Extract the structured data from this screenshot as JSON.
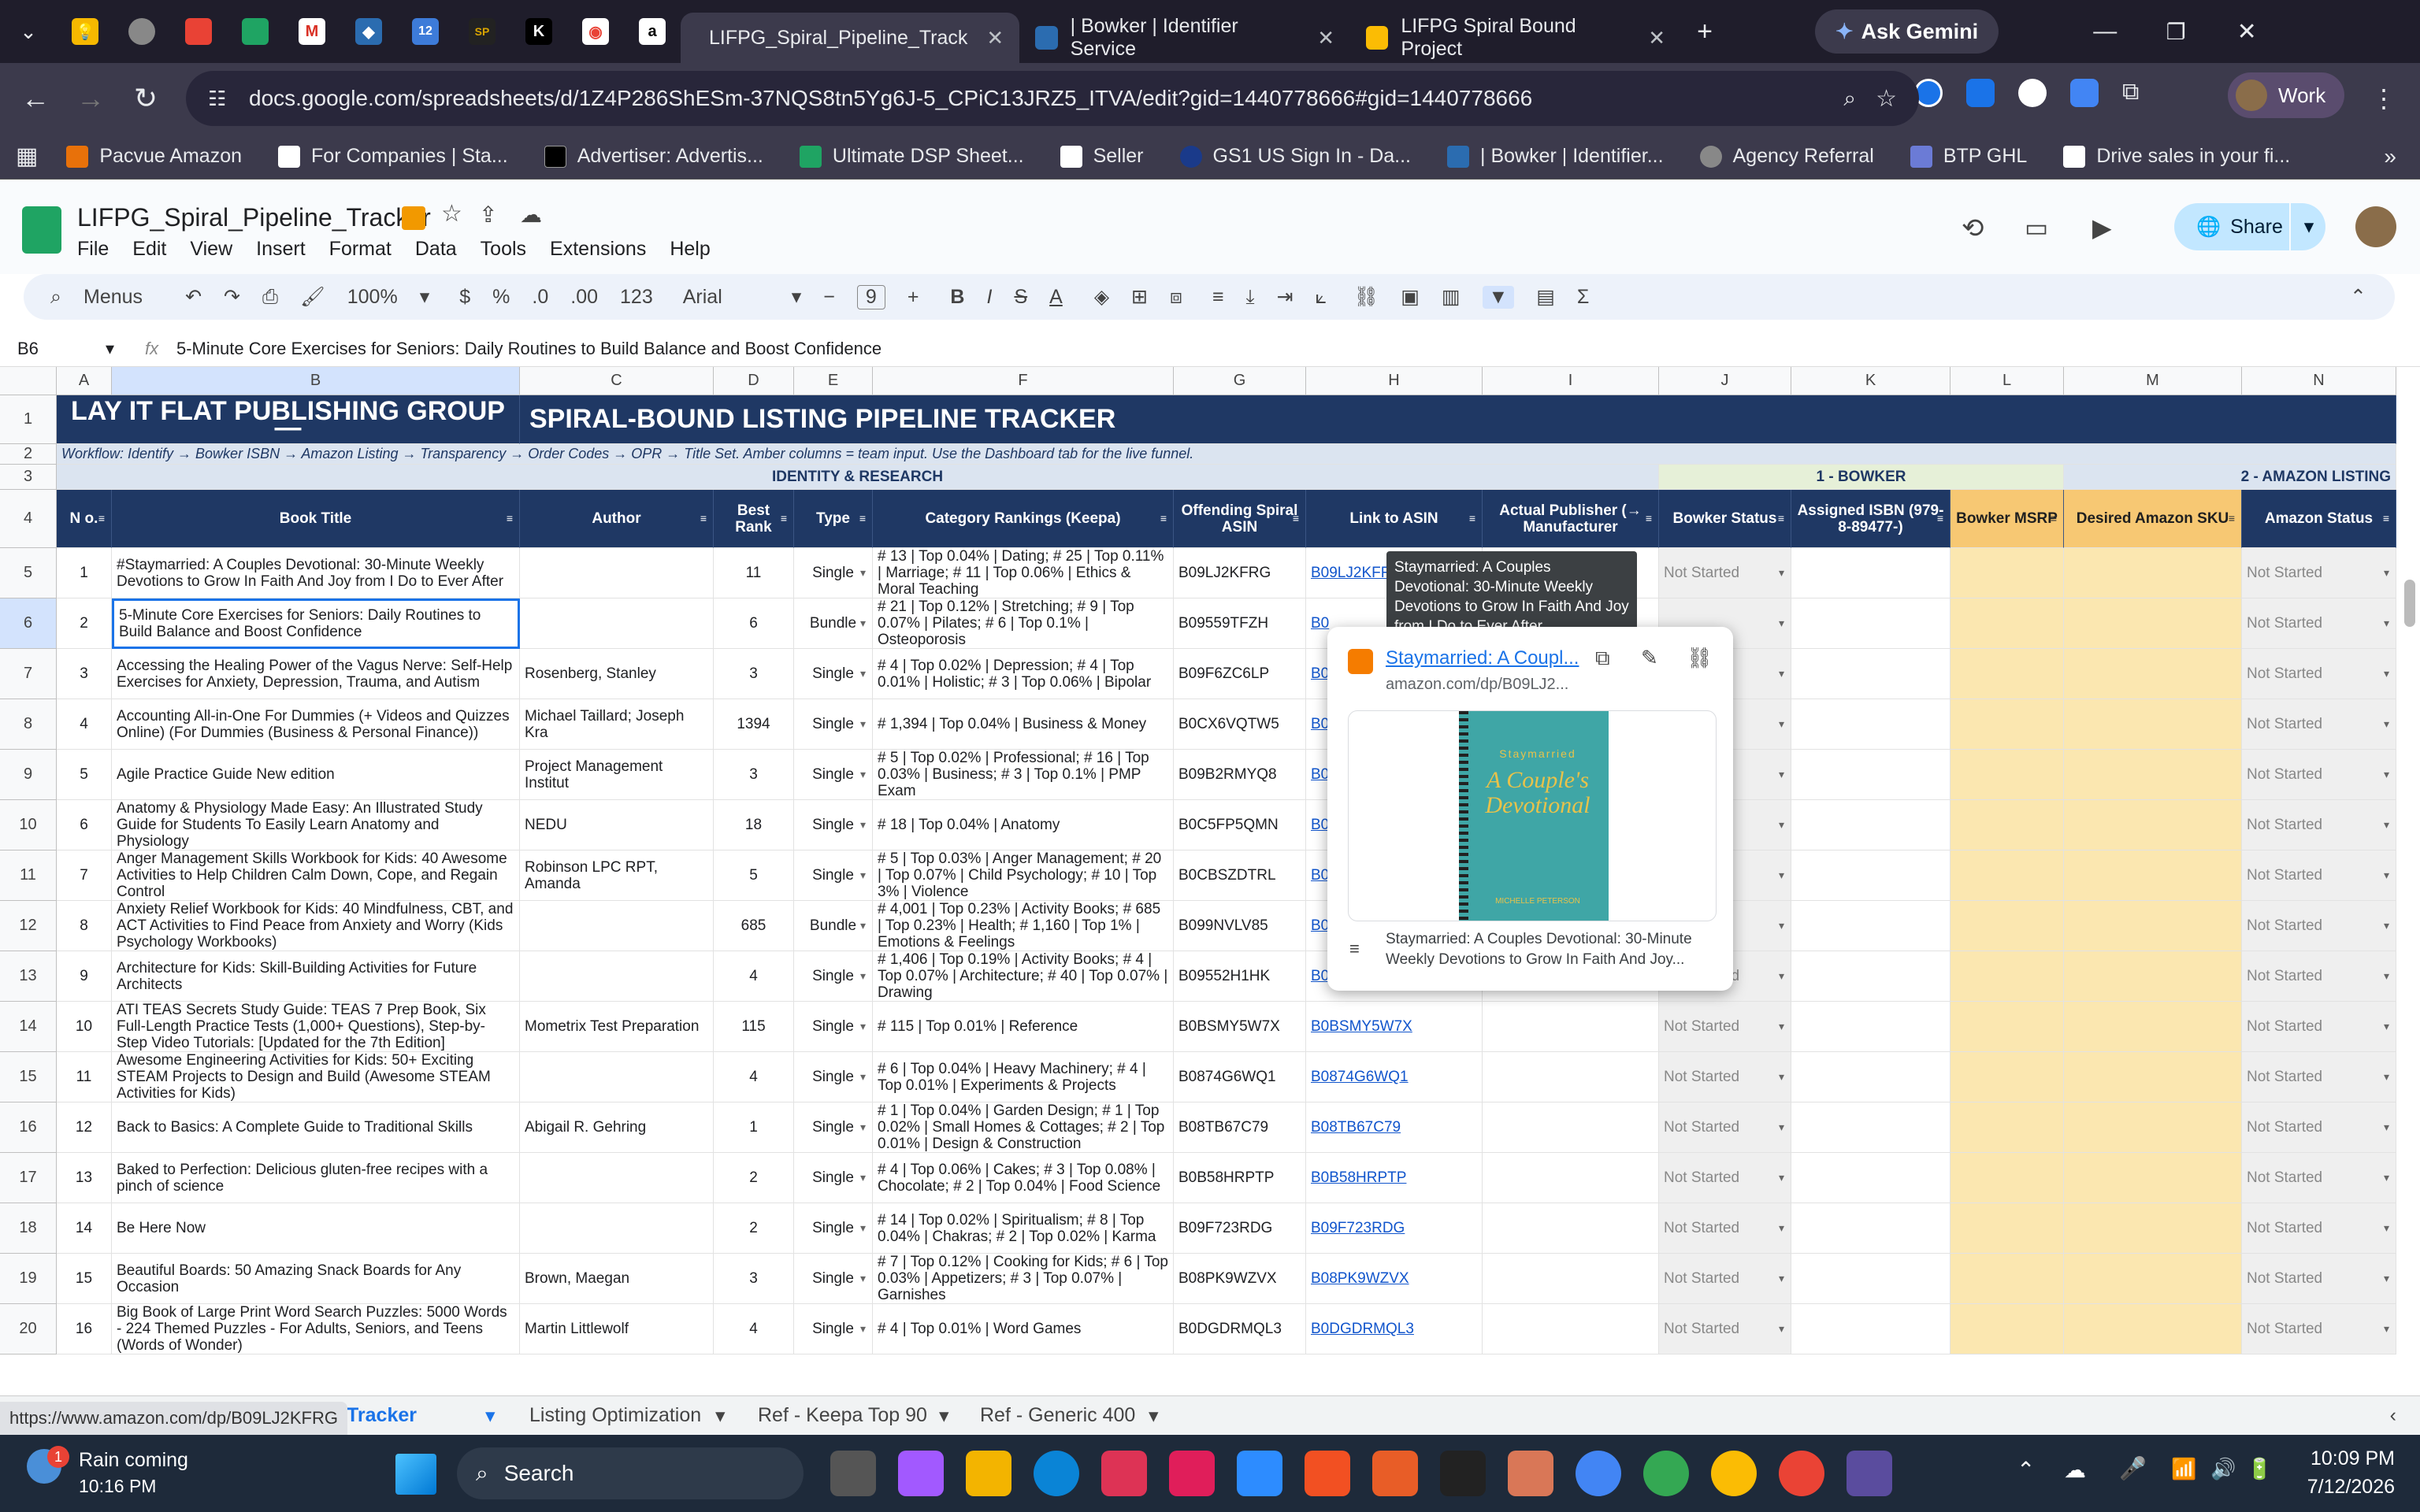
{
  "browser": {
    "tabs": [
      {
        "label": "LIFPG_Spiral_Pipeline_Track",
        "active": true
      },
      {
        "label": "| Bowker | Identifier Service",
        "active": false
      },
      {
        "label": "LIFPG Spiral Bound Project",
        "active": false
      }
    ],
    "gemini_label": "Ask Gemini",
    "url": "docs.google.com/spreadsheets/d/1Z4P286ShESm-37NQS8tn5Yg6J-5_CPiC13JRZ5_ITVA/edit?gid=1440778666#gid=1440778666",
    "profile_label": "Work",
    "bookmarks": [
      "Pacvue Amazon",
      "For Companies | Sta...",
      "Advertiser: Advertis...",
      "Ultimate DSP Sheet...",
      "Seller",
      "GS1 US Sign In - Da...",
      "| Bowker | Identifier...",
      "Agency Referral",
      "BTP GHL",
      "Drive sales in your fi..."
    ]
  },
  "doc": {
    "title": "LIFPG_Spiral_Pipeline_Tracker",
    "menu": [
      "File",
      "Edit",
      "View",
      "Insert",
      "Format",
      "Data",
      "Tools",
      "Extensions",
      "Help"
    ],
    "share_label": "Share"
  },
  "toolbar": {
    "menus_label": "Menus",
    "zoom": "100%",
    "currency": "$",
    "percent": "%",
    "dec_less": ".0",
    "dec_more": ".00",
    "format_123": "123",
    "font": "Arial",
    "font_size": "9"
  },
  "formula": {
    "cell_ref": "B6",
    "fx": "fx",
    "content": "5-Minute Core Exercises for Seniors: Daily Routines to Build Balance and Boost Confidence"
  },
  "columns": [
    "A",
    "B",
    "C",
    "D",
    "E",
    "F",
    "G",
    "H",
    "I",
    "J",
    "K",
    "L",
    "M",
    "N"
  ],
  "banner": {
    "left": "LAY IT FLAT PUBLISHING GROUP  —",
    "right": "SPIRAL-BOUND LISTING PIPELINE TRACKER"
  },
  "workflow": "Workflow:  Identify → Bowker ISBN → Amazon Listing → Transparency → Order Codes → OPR → Title Set.  Amber columns = team input.  Use the Dashboard tab for the live funnel.",
  "sections": {
    "identity": "IDENTITY & RESEARCH",
    "bowker": "1 - BOWKER",
    "amazon": "2 - AMAZON LISTING"
  },
  "headers": [
    "N o.",
    "Book Title",
    "Author",
    "Best Rank",
    "Type",
    "Category Rankings (Keepa)",
    "Offending Spiral ASIN",
    "Link to ASIN",
    "Actual Publisher (→ Manufacturer",
    "Bowker Status",
    "Assigned ISBN (979-8-89477-)",
    "Bowker MSRP",
    "Desired Amazon SKU",
    "Amazon Status"
  ],
  "rows": [
    {
      "r": "5",
      "no": "1",
      "title": "#Staymarried: A Couples Devotional: 30-Minute Weekly Devotions to Grow In Faith And Joy from I Do to Ever After",
      "author": "",
      "rank": "11",
      "type": "Single",
      "cat": "# 13 | Top 0.04% | Dating; # 25 | Top 0.11% | Marriage; # 11 | Top 0.06% | Ethics & Moral Teaching",
      "asin": "B09LJ2KFRG",
      "link": "B09LJ2KFR",
      "bstatus": "Not Started",
      "astatus": "Not Started"
    },
    {
      "r": "6",
      "no": "2",
      "title": "5-Minute Core Exercises for Seniors: Daily Routines to Build Balance and Boost Confidence",
      "author": "",
      "rank": "6",
      "type": "Bundle",
      "cat": "# 21 | Top 0.12% | Stretching; # 9 | Top 0.07% | Pilates; # 6 | Top 0.1% | Osteoporosis",
      "asin": "B09559TFZH",
      "link": "B0",
      "bstatus": "",
      "astatus": "Not Started"
    },
    {
      "r": "7",
      "no": "3",
      "title": "Accessing the Healing Power of the Vagus Nerve: Self-Help Exercises for Anxiety, Depression, Trauma, and Autism",
      "author": "Rosenberg, Stanley",
      "rank": "3",
      "type": "Single",
      "cat": "# 4 | Top 0.02% | Depression; # 4 | Top 0.01% | Holistic; # 3 | Top 0.06% | Bipolar",
      "asin": "B09F6ZC6LP",
      "link": "B0",
      "bstatus": "",
      "astatus": "Not Started"
    },
    {
      "r": "8",
      "no": "4",
      "title": "Accounting All-in-One For Dummies (+ Videos and Quizzes Online) (For Dummies (Business & Personal Finance))",
      "author": "Michael Taillard; Joseph Kra",
      "rank": "1394",
      "type": "Single",
      "cat": "# 1,394 | Top 0.04% | Business & Money",
      "asin": "B0CX6VQTW5",
      "link": "B0",
      "bstatus": "",
      "astatus": "Not Started"
    },
    {
      "r": "9",
      "no": "5",
      "title": "Agile Practice Guide New edition",
      "author": "Project Management Institut",
      "rank": "3",
      "type": "Single",
      "cat": "# 5 | Top 0.02% | Professional; # 16 | Top 0.03% | Business; # 3 | Top 0.1% | PMP Exam",
      "asin": "B09B2RMYQ8",
      "link": "B0",
      "bstatus": "",
      "astatus": "Not Started"
    },
    {
      "r": "10",
      "no": "6",
      "title": "Anatomy & Physiology Made Easy: An Illustrated Study Guide for Students To Easily Learn Anatomy and Physiology",
      "author": "NEDU",
      "rank": "18",
      "type": "Single",
      "cat": "# 18 | Top 0.04% | Anatomy",
      "asin": "B0C5FP5QMN",
      "link": "B0",
      "bstatus": "",
      "astatus": "Not Started"
    },
    {
      "r": "11",
      "no": "7",
      "title": "Anger Management Skills Workbook for Kids: 40 Awesome Activities to Help Children Calm Down, Cope, and Regain Control",
      "author": "Robinson LPC RPT, Amanda",
      "rank": "5",
      "type": "Single",
      "cat": "# 5 | Top 0.03% | Anger Management; # 20 | Top 0.07% | Child Psychology; # 10 | Top 3% | Violence",
      "asin": "B0CBSZDTRL",
      "link": "B0",
      "bstatus": "",
      "astatus": "Not Started"
    },
    {
      "r": "12",
      "no": "8",
      "title": "Anxiety Relief Workbook for Kids: 40 Mindfulness, CBT, and ACT Activities to Find Peace from Anxiety and Worry (Kids Psychology Workbooks)",
      "author": "",
      "rank": "685",
      "type": "Bundle",
      "cat": "# 4,001 | Top 0.23% | Activity Books; # 685 | Top 0.23% | Health; # 1,160 | Top 1% | Emotions & Feelings",
      "asin": "B099NVLV85",
      "link": "B0",
      "bstatus": "",
      "astatus": "Not Started"
    },
    {
      "r": "13",
      "no": "9",
      "title": "Architecture for Kids: Skill-Building Activities for Future Architects",
      "author": "",
      "rank": "4",
      "type": "Single",
      "cat": "# 1,406 | Top 0.19% | Activity Books; # 4 | Top 0.07% | Architecture; # 40 | Top 0.07% | Drawing",
      "asin": "B09552H1HK",
      "link": "B09552H1HK",
      "bstatus": "Not Started",
      "astatus": "Not Started"
    },
    {
      "r": "14",
      "no": "10",
      "title": "ATI TEAS Secrets Study Guide: TEAS 7 Prep Book, Six Full-Length Practice Tests (1,000+ Questions), Step-by-Step Video Tutorials: [Updated for the 7th Edition]",
      "author": "Mometrix Test Preparation",
      "rank": "115",
      "type": "Single",
      "cat": "# 115 | Top 0.01% | Reference",
      "asin": "B0BSMY5W7X",
      "link": "B0BSMY5W7X",
      "bstatus": "Not Started",
      "astatus": "Not Started"
    },
    {
      "r": "15",
      "no": "11",
      "title": "Awesome Engineering Activities for Kids: 50+ Exciting STEAM Projects to Design and Build (Awesome STEAM Activities for Kids)",
      "author": "",
      "rank": "4",
      "type": "Single",
      "cat": "# 6 | Top 0.04% | Heavy Machinery; # 4 | Top 0.01% | Experiments & Projects",
      "asin": "B0874G6WQ1",
      "link": "B0874G6WQ1",
      "bstatus": "Not Started",
      "astatus": "Not Started"
    },
    {
      "r": "16",
      "no": "12",
      "title": "Back to Basics: A Complete Guide to Traditional Skills",
      "author": "Abigail R. Gehring",
      "rank": "1",
      "type": "Single",
      "cat": "# 1 | Top 0.04% | Garden Design; # 1 | Top 0.02% | Small Homes & Cottages; # 2 | Top 0.01% | Design & Construction",
      "asin": "B08TB67C79",
      "link": "B08TB67C79",
      "bstatus": "Not Started",
      "astatus": "Not Started"
    },
    {
      "r": "17",
      "no": "13",
      "title": "Baked to Perfection: Delicious gluten-free recipes with a pinch of science",
      "author": "",
      "rank": "2",
      "type": "Single",
      "cat": "# 4 | Top 0.06% | Cakes; # 3 | Top 0.08% | Chocolate; # 2 | Top 0.04% | Food Science",
      "asin": "B0B58HRPTP",
      "link": "B0B58HRPTP",
      "bstatus": "Not Started",
      "astatus": "Not Started"
    },
    {
      "r": "18",
      "no": "14",
      "title": "Be Here Now",
      "author": "",
      "rank": "2",
      "type": "Single",
      "cat": "# 14 | Top 0.02% | Spiritualism; # 8 | Top 0.04% | Chakras; # 2 | Top 0.02% | Karma",
      "asin": "B09F723RDG",
      "link": "B09F723RDG",
      "bstatus": "Not Started",
      "astatus": "Not Started"
    },
    {
      "r": "19",
      "no": "15",
      "title": "Beautiful Boards: 50 Amazing Snack Boards for Any Occasion",
      "author": "Brown, Maegan",
      "rank": "3",
      "type": "Single",
      "cat": "# 7 | Top 0.12% | Cooking for Kids; # 6 | Top 0.03% | Appetizers; # 3 | Top 0.07% | Garnishes",
      "asin": "B08PK9WZVX",
      "link": "B08PK9WZVX",
      "bstatus": "Not Started",
      "astatus": "Not Started"
    },
    {
      "r": "20",
      "no": "16",
      "title": "Big Book of Large Print Word Search Puzzles: 5000 Words - 224 Themed Puzzles - For Adults, Seniors, and Teens (Words of Wonder)",
      "author": "Martin Littlewolf",
      "rank": "4",
      "type": "Single",
      "cat": "# 4 | Top 0.01% | Word Games",
      "asin": "B0DGDRMQL3",
      "link": "B0DGDRMQL3",
      "bstatus": "Not Started",
      "astatus": "Not Started"
    }
  ],
  "tooltip": "Staymarried: A Couples Devotional: 30-Minute Weekly Devotions to Grow In Faith And Joy from I Do to Ever After",
  "popup": {
    "title": "Staymarried: A Coupl...",
    "domain": "amazon.com/dp/B09LJ2...",
    "cover_brand": "Staymarried",
    "cover_title": "A Couple's Devotional",
    "cover_author": "MICHELLE PETERSON",
    "snippet": "Staymarried: A Couples Devotional: 30-Minute Weekly Devotions to Grow In Faith And Joy..."
  },
  "sheet_tabs": [
    "line Tracker",
    "Listing Optimization",
    "Ref - Keepa Top 90",
    "Ref - Generic 400"
  ],
  "status_url": "https://www.amazon.com/dp/B09LJ2KFRG",
  "taskbar": {
    "weather": "Rain coming",
    "weather_time": "10:16 PM",
    "search": "Search",
    "time": "10:09 PM",
    "date": "7/12/2026",
    "notification_count": "1"
  }
}
